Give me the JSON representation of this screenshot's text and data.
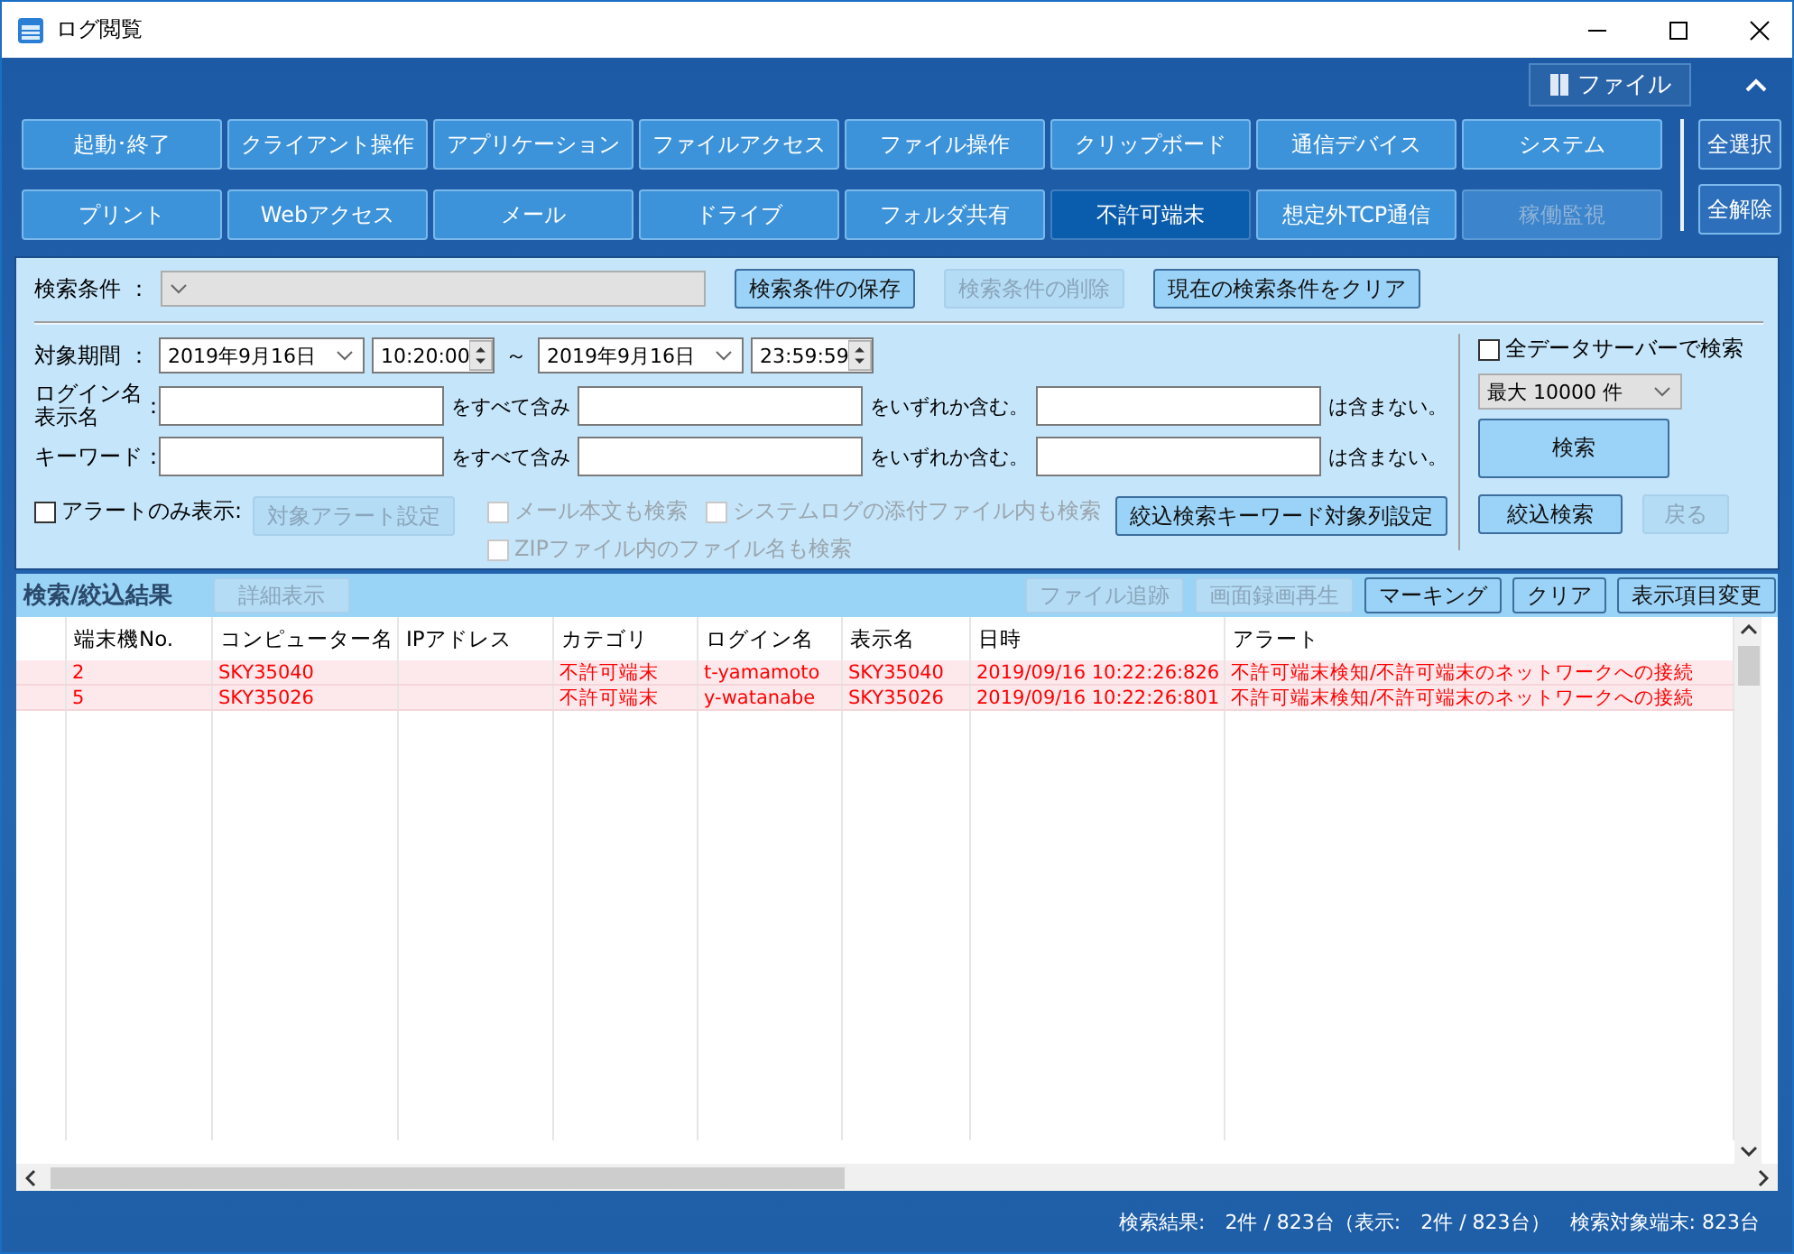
{
  "window": {
    "title": "ログ閲覧"
  },
  "toolbar": {
    "file_button": "ファイル"
  },
  "categories": [
    {
      "label": "起動･終了",
      "selected": false,
      "disabled": false
    },
    {
      "label": "クライアント操作",
      "selected": false,
      "disabled": false
    },
    {
      "label": "アプリケーション",
      "selected": false,
      "disabled": false
    },
    {
      "label": "ファイルアクセス",
      "selected": false,
      "disabled": false
    },
    {
      "label": "ファイル操作",
      "selected": false,
      "disabled": false
    },
    {
      "label": "クリップボード",
      "selected": false,
      "disabled": false
    },
    {
      "label": "通信デバイス",
      "selected": false,
      "disabled": false
    },
    {
      "label": "システム",
      "selected": false,
      "disabled": false
    },
    {
      "label": "プリント",
      "selected": false,
      "disabled": false
    },
    {
      "label": "Webアクセス",
      "selected": false,
      "disabled": false
    },
    {
      "label": "メール",
      "selected": false,
      "disabled": false
    },
    {
      "label": "ドライブ",
      "selected": false,
      "disabled": false
    },
    {
      "label": "フォルダ共有",
      "selected": false,
      "disabled": false
    },
    {
      "label": "不許可端末",
      "selected": true,
      "disabled": false
    },
    {
      "label": "想定外TCP通信",
      "selected": false,
      "disabled": false
    },
    {
      "label": "稼働監視",
      "selected": false,
      "disabled": true
    }
  ],
  "selection_buttons": [
    "全選択",
    "全解除"
  ],
  "search": {
    "condition_label": "検索条件 ：",
    "condition_buttons": [
      {
        "label": "検索条件の保存",
        "disabled": false
      },
      {
        "label": "検索条件の削除",
        "disabled": true
      },
      {
        "label": "現在の検索条件をクリア",
        "disabled": false
      }
    ],
    "period": {
      "label": "対象期間 ：",
      "from_date": "2019年9月16日",
      "from_time": "10:20:00",
      "separator": "～",
      "to_date": "2019年9月16日",
      "to_time": "23:59:59"
    },
    "filters": [
      {
        "label_lines": [
          "ログイン名",
          "表示名"
        ],
        "colon": "：",
        "all_text": "をすべて含み",
        "any_text": "をいずれか含む。",
        "none_text": "は含まない。"
      },
      {
        "label_lines": [
          "キーワード"
        ],
        "colon": "：",
        "all_text": "をすべて含み",
        "any_text": "をいずれか含む。",
        "none_text": "は含まない。"
      }
    ],
    "alert_only": {
      "label": "アラートのみ表示:",
      "checked": false
    },
    "alert_settings_button": {
      "label": "対象アラート設定",
      "disabled": true
    },
    "options": [
      {
        "label": "メール本文も検索",
        "checked": false,
        "disabled": true
      },
      {
        "label": "システムログの添付ファイル内も検索",
        "checked": false,
        "disabled": true
      },
      {
        "label": "ZIPファイル内のファイル名も検索",
        "checked": false,
        "disabled": true
      }
    ],
    "keyword_columns_button": "絞込検索キーワード対象列設定",
    "all_servers": {
      "label": "全データサーバーで検索",
      "checked": false
    },
    "max_results": "最大 10000 件",
    "search_button": "検索",
    "refine_button": "絞込検索",
    "back_button": {
      "label": "戻る",
      "disabled": true
    }
  },
  "results": {
    "title": "検索/絞込結果",
    "detail_button": {
      "label": "詳細表示",
      "disabled": true
    },
    "buttons": [
      {
        "label": "ファイル追跡",
        "disabled": true
      },
      {
        "label": "画面録画再生",
        "disabled": true
      },
      {
        "label": "マーキング",
        "disabled": false
      },
      {
        "label": "クリア",
        "disabled": false
      },
      {
        "label": "表示項目変更",
        "disabled": false
      }
    ]
  },
  "table": {
    "columns": [
      "端末機No.",
      "コンピューター名",
      "IPアドレス",
      "カテゴリ",
      "ログイン名",
      "表示名",
      "日時",
      "アラート"
    ],
    "rows": [
      {
        "highlighted": true,
        "cells": [
          "2",
          "SKY35040",
          "",
          "不許可端末",
          "t-yamamoto",
          "SKY35040",
          "2019/09/16 10:22:26:826",
          "不許可端末検知/不許可端末のネットワークへの接続"
        ]
      },
      {
        "highlighted": true,
        "cells": [
          "5",
          "SKY35026",
          "",
          "不許可端末",
          "y-watanabe",
          "SKY35026",
          "2019/09/16 10:22:26:801",
          "不許可端末検知/不許可端末のネットワークへの接続"
        ]
      }
    ]
  },
  "status_bar": {
    "text": "検索結果:　2件 / 823台（表示:　2件 / 823台）　検索対象端末: 823台"
  }
}
